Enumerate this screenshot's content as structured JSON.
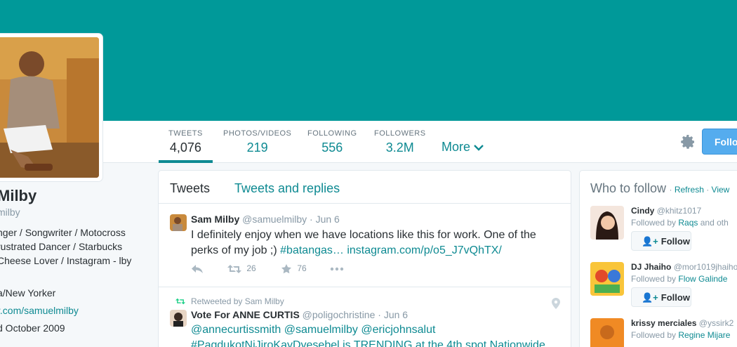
{
  "profile": {
    "name": "Milby",
    "handle": "milby",
    "bio": "nger / Songwriter / Motocross rustrated Dancer / Starbucks Cheese Lover / Instagram - lby",
    "location": "a/New Yorker",
    "url": "r.com/samuelmilby",
    "joined": "d October 2009"
  },
  "nav": {
    "stats": [
      {
        "label": "TWEETS",
        "value": "4,076"
      },
      {
        "label": "PHOTOS/VIDEOS",
        "value": "219"
      },
      {
        "label": "FOLLOWING",
        "value": "556"
      },
      {
        "label": "FOLLOWERS",
        "value": "3.2M"
      }
    ],
    "more_label": "More",
    "follow_label": "Follo"
  },
  "timeline": {
    "tabs": [
      "Tweets",
      "Tweets and replies"
    ],
    "tweets": [
      {
        "fullname": "Sam Milby",
        "screenname": "@samuelmilby",
        "date": "· Jun 6",
        "text": "I definitely enjoy when we have locations like this for work. One of the perks of my job ;) ",
        "hashtag": "#batangas…",
        "link": " instagram.com/p/o5_J7vQhTX/",
        "retweets": "26",
        "favorites": "76"
      },
      {
        "retweeted_by": "Retweeted by Sam Milby",
        "fullname": "Vote For ANNE CURTIS",
        "screenname": "@poligochristine",
        "date": "· Jun 6",
        "mentions": "@annecurtissmith @samuelmilby @ericjohnsalut",
        "text2": "#PagdukotNiJiroKayDyesebel is TRENDING at the 4th spot Nationwide"
      }
    ]
  },
  "who_to_follow": {
    "title": "Who to follow",
    "refresh": "Refresh",
    "view": "View",
    "follow_label": "Follow",
    "followed_by_prefix": "Followed by",
    "suggestions": [
      {
        "name": "Cindy",
        "handle": "@khitz1017",
        "followed_by": "Raqs",
        "suffix": " and oth"
      },
      {
        "name": "DJ Jhaiho",
        "handle": "@mor1019jhaiho",
        "followed_by": "Flow Galinde",
        "suffix": ""
      },
      {
        "name": "krissy merciales",
        "handle": "@yssirk2",
        "followed_by": "Regine Mijare",
        "suffix": ""
      }
    ]
  },
  "colors": {
    "banner": "#009999",
    "accent": "#0e8a92",
    "follow_button": "#55acee"
  }
}
